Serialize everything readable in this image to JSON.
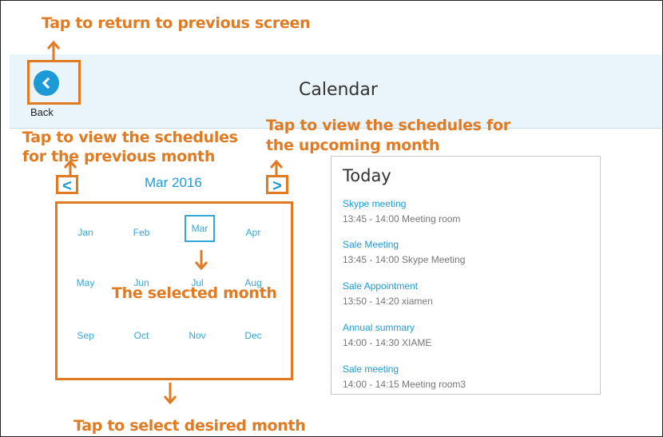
{
  "annotations": {
    "back": "Tap to return to previous screen",
    "prev_line1": "Tap to view the schedules",
    "prev_line2": "for the previous month",
    "next_line1": "Tap to view the schedules for",
    "next_line2": "the upcoming month",
    "selected": "The selected month",
    "select": "Tap to select desired month"
  },
  "header": {
    "title": "Calendar",
    "back_label": "Back"
  },
  "nav": {
    "current_month": "Mar 2016",
    "prev_symbol": "<",
    "next_symbol": ">"
  },
  "months": [
    "Jan",
    "Feb",
    "Mar",
    "Apr",
    "May",
    "Jun",
    "Jul",
    "Aug",
    "Sep",
    "Oct",
    "Nov",
    "Dec"
  ],
  "today": {
    "title": "Today",
    "events": [
      {
        "name": "Skype meeting",
        "detail": "13:45 - 14:00 Meeting room"
      },
      {
        "name": "Sale Meeting",
        "detail": "13:45 - 14:00 Skype Meeting"
      },
      {
        "name": "Sale Appointment",
        "detail": "13:50 - 14:20 xiamen"
      },
      {
        "name": "Annual summary",
        "detail": "14:00 - 14:30 XIAME"
      },
      {
        "name": "Sale meeting",
        "detail": "14:00 - 14:15 Meeting room3"
      }
    ]
  },
  "colors": {
    "annotation": "#e07b24",
    "accent": "#1d9ad6",
    "header_bg": "#eaf4fb"
  }
}
